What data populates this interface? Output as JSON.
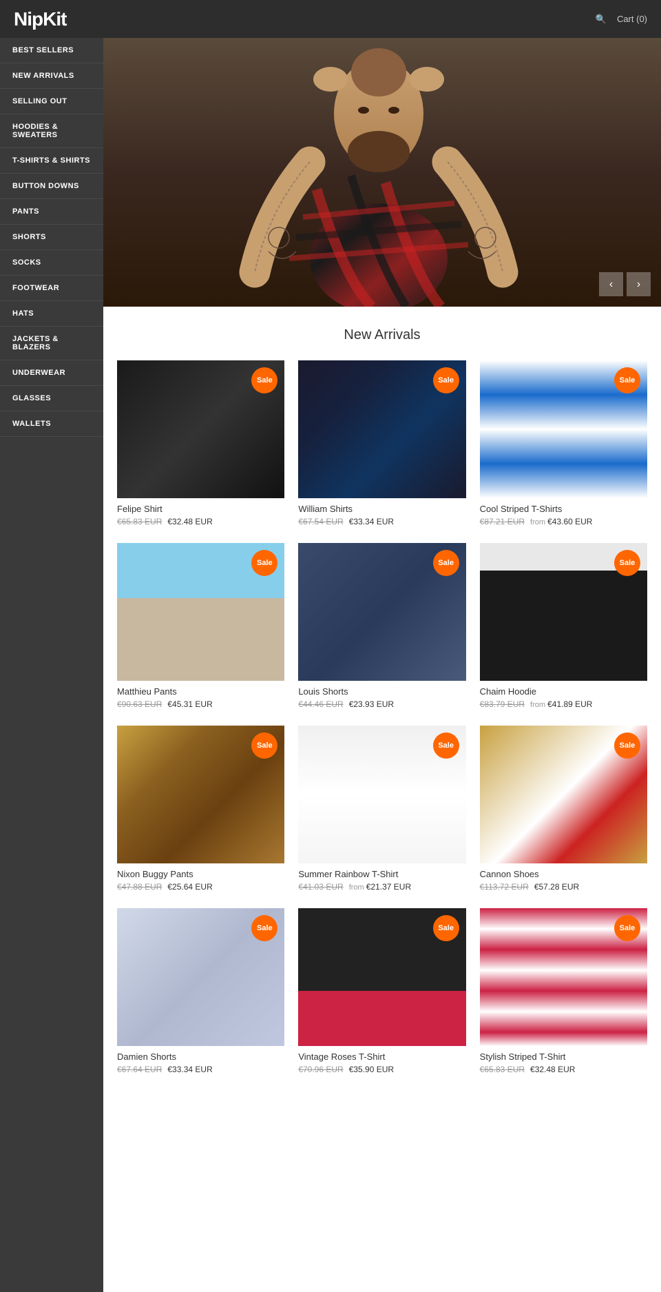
{
  "header": {
    "logo": "NipKit",
    "search_label": "🔍",
    "cart_label": "Cart (0)"
  },
  "sidebar": {
    "items": [
      {
        "label": "BEST SELLERS",
        "key": "best-sellers"
      },
      {
        "label": "NEW ARRIVALS",
        "key": "new-arrivals"
      },
      {
        "label": "SELLING OUT",
        "key": "selling-out"
      },
      {
        "label": "HOODIES & SWEATERS",
        "key": "hoodies-sweaters"
      },
      {
        "label": "T-SHIRTS & SHIRTS",
        "key": "tshirts-shirts"
      },
      {
        "label": "BUTTON DOWNS",
        "key": "button-downs"
      },
      {
        "label": "PANTS",
        "key": "pants"
      },
      {
        "label": "SHORTS",
        "key": "shorts"
      },
      {
        "label": "SOCKS",
        "key": "socks"
      },
      {
        "label": "FOOTWEAR",
        "key": "footwear"
      },
      {
        "label": "HATS",
        "key": "hats"
      },
      {
        "label": "JACKETS & BLAZERS",
        "key": "jackets-blazers"
      },
      {
        "label": "UNDERWEAR",
        "key": "underwear"
      },
      {
        "label": "GLASSES",
        "key": "glasses"
      },
      {
        "label": "WALLETS",
        "key": "wallets"
      }
    ]
  },
  "hero": {
    "prev_label": "‹",
    "next_label": "›"
  },
  "products_section": {
    "title": "New Arrivals",
    "sale_badge": "Sale",
    "products": [
      {
        "name": "Felipe Shirt",
        "original_price": "€65.83 EUR",
        "sale_price": "€32.48 EUR",
        "from": false,
        "image_class": "img-black-shirt",
        "on_sale": true
      },
      {
        "name": "William Shirts",
        "original_price": "€67.54 EUR",
        "sale_price": "€33.34 EUR",
        "from": false,
        "image_class": "img-floral-shirt",
        "on_sale": true
      },
      {
        "name": "Cool Striped T-Shirts",
        "original_price": "€87.21 EUR",
        "sale_price": "€43.60 EUR",
        "from": true,
        "image_class": "img-striped-shirt",
        "on_sale": true
      },
      {
        "name": "Matthieu Pants",
        "original_price": "€90.63 EUR",
        "sale_price": "€45.31 EUR",
        "from": false,
        "image_class": "img-stripe-pants",
        "on_sale": true
      },
      {
        "name": "Louis Shorts",
        "original_price": "€44.46 EUR",
        "sale_price": "€23.93 EUR",
        "from": false,
        "image_class": "img-shorts",
        "on_sale": true
      },
      {
        "name": "Chaim Hoodie",
        "original_price": "€83.79 EUR",
        "sale_price": "€41.89 EUR",
        "from": true,
        "image_class": "img-hoodie",
        "on_sale": true
      },
      {
        "name": "Nixon Buggy Pants",
        "original_price": "€47.88 EUR",
        "sale_price": "€25.64 EUR",
        "from": false,
        "image_class": "img-boho-pants",
        "on_sale": true
      },
      {
        "name": "Summer Rainbow T-Shirt",
        "original_price": "€41.03 EUR",
        "sale_price": "€21.37 EUR",
        "from": true,
        "image_class": "img-white-tshirt",
        "on_sale": true
      },
      {
        "name": "Cannon Shoes",
        "original_price": "€113.72 EUR",
        "sale_price": "€57.28 EUR",
        "from": false,
        "image_class": "img-sneakers",
        "on_sale": true
      },
      {
        "name": "Damien Shorts",
        "original_price": "€67.64 EUR",
        "sale_price": "€33.34 EUR",
        "from": false,
        "image_class": "img-floral-shorts",
        "on_sale": true
      },
      {
        "name": "Vintage Roses T-Shirt",
        "original_price": "€70.96 EUR",
        "sale_price": "€35.90 EUR",
        "from": false,
        "image_class": "img-rose-tshirt",
        "on_sale": true
      },
      {
        "name": "Stylish Striped T-Shirt",
        "original_price": "€65.83 EUR",
        "sale_price": "€32.48 EUR",
        "from": false,
        "image_class": "img-stripe-longshirt",
        "on_sale": true
      }
    ]
  }
}
